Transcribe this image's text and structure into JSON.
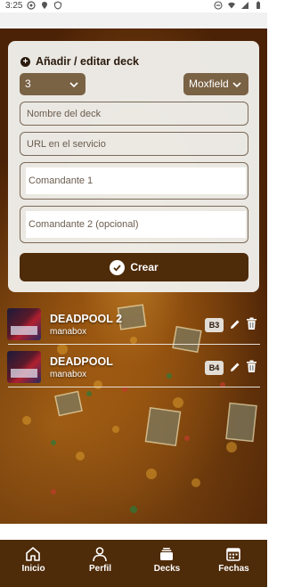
{
  "status_bar": {
    "time": "3:25"
  },
  "form": {
    "title": "Añadir / editar deck",
    "count_select": {
      "selected": "3"
    },
    "service_select": {
      "selected": "Moxfield"
    },
    "deck_name": {
      "placeholder": "Nombre del deck"
    },
    "service_url": {
      "placeholder": "URL en el servicio"
    },
    "commander_1": {
      "placeholder": "Comandante 1"
    },
    "commander_2": {
      "placeholder": "Comandante 2 (opcional)"
    },
    "create_label": "Crear"
  },
  "decks": [
    {
      "name": "DEADPOOL 2",
      "service": "manabox",
      "badge": "B3"
    },
    {
      "name": "DEADPOOL",
      "service": "manabox",
      "badge": "B4"
    }
  ],
  "nav": [
    {
      "label": "Inicio",
      "icon": "home-icon"
    },
    {
      "label": "Perfil",
      "icon": "person-icon"
    },
    {
      "label": "Decks",
      "icon": "cards-icon"
    },
    {
      "label": "Fechas",
      "icon": "calendar-icon"
    }
  ],
  "colors": {
    "primary_brown": "#4e2b09",
    "select_brown": "#7a6245",
    "badge_bg": "#e2ddd6"
  }
}
